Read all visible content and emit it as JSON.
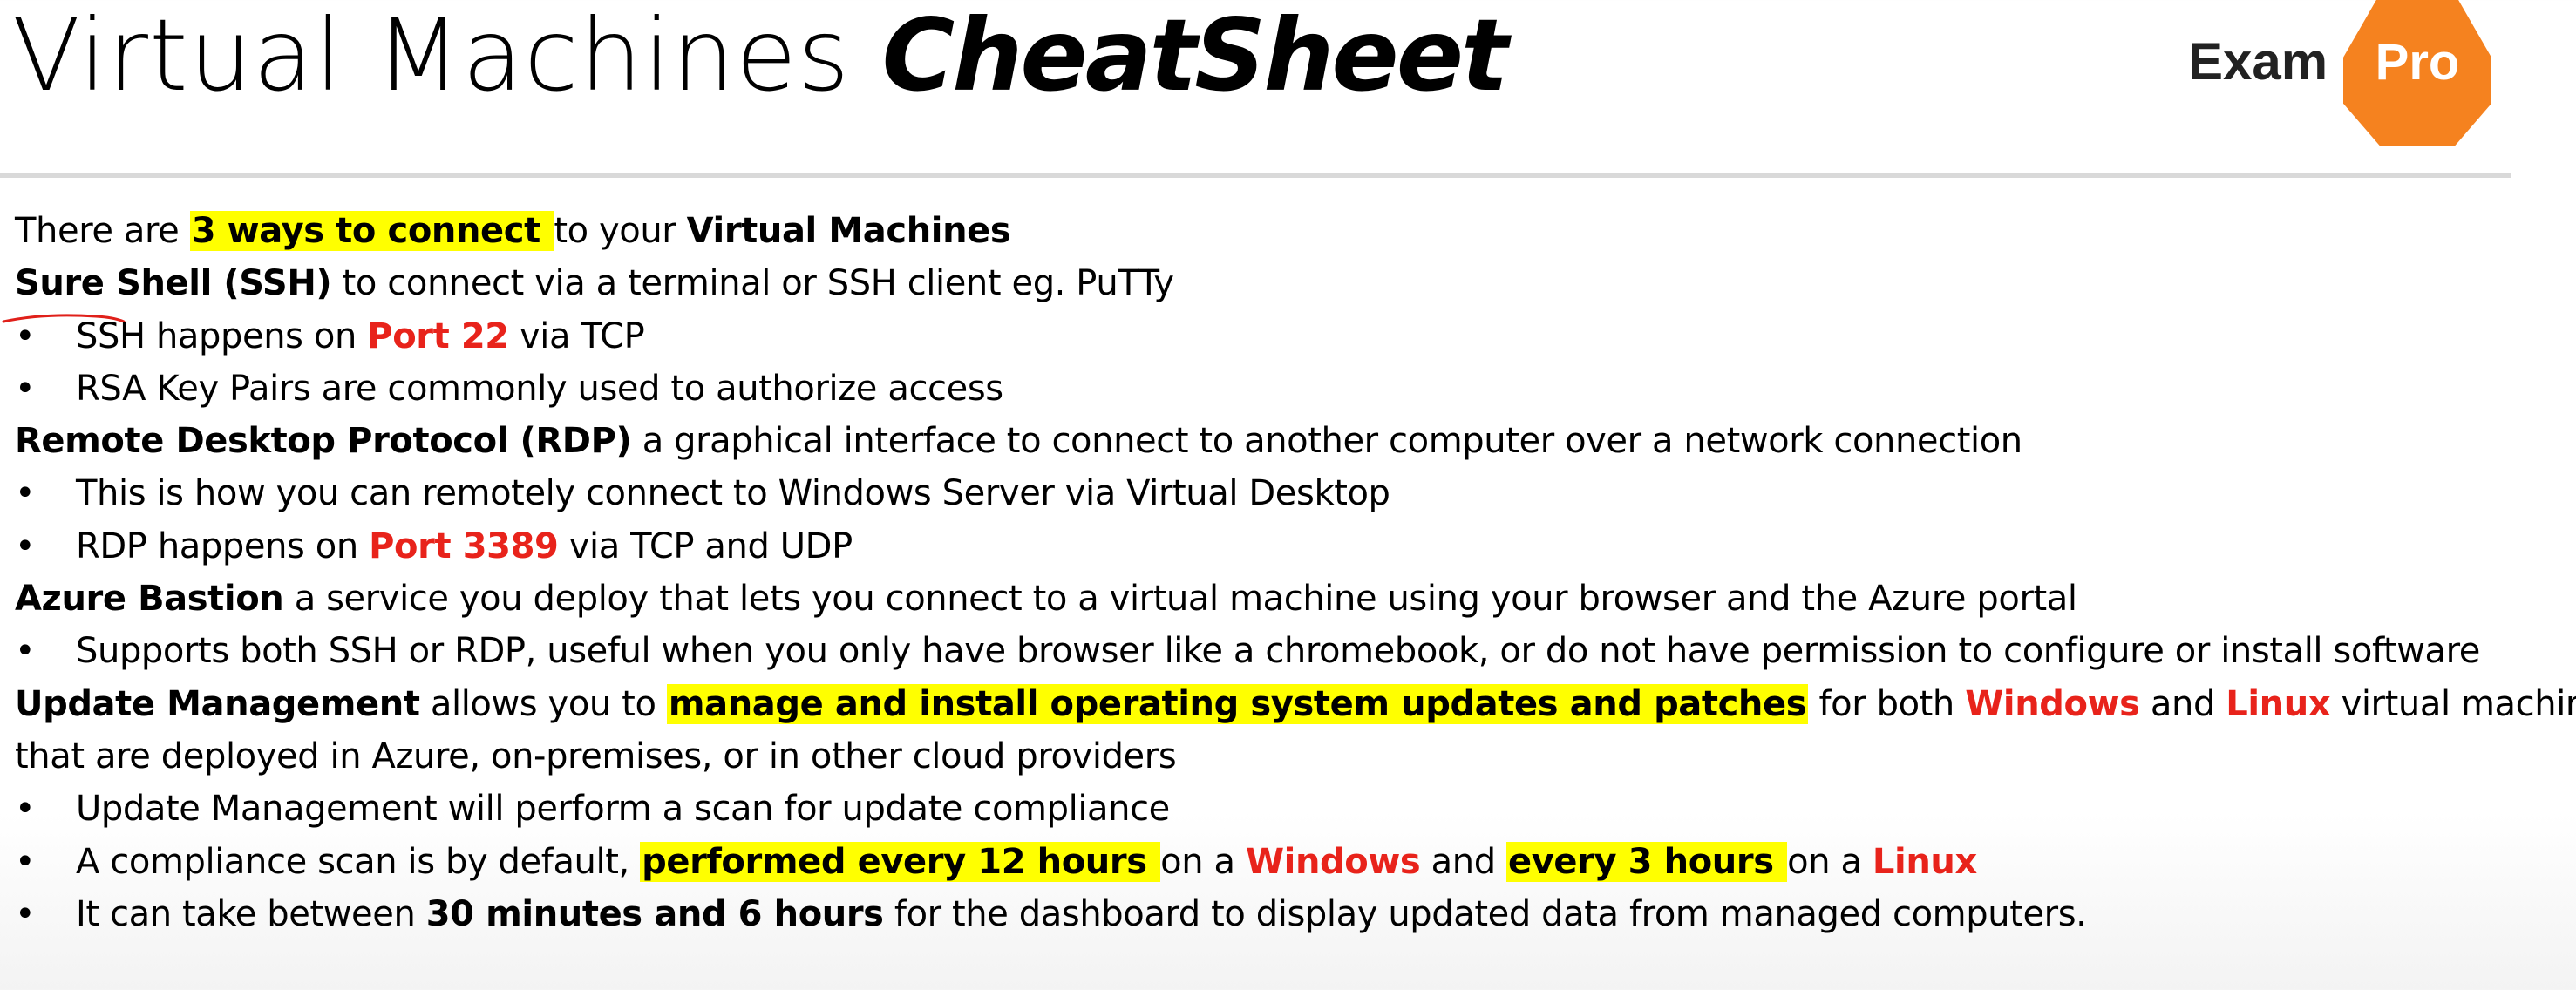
{
  "header": {
    "title_light": "Virtual Machines",
    "title_bold": "CheatSheet",
    "logo_left": "Exam",
    "logo_right": "Pro",
    "brand_color": "#f5821f"
  },
  "lines": [
    {
      "bullet": false,
      "segments": [
        {
          "t": "There are ",
          "s": ""
        },
        {
          "t": "3 ways to connect ",
          "s": "b hl"
        },
        {
          "t": "to your ",
          "s": ""
        },
        {
          "t": "Virtual Machines",
          "s": "b"
        }
      ]
    },
    {
      "bullet": false,
      "segments": [
        {
          "t": "Sure Shell (SSH)",
          "s": "b"
        },
        {
          "t": " to connect via a terminal or SSH client eg. PuTTy",
          "s": ""
        }
      ]
    },
    {
      "bullet": true,
      "segments": [
        {
          "t": "SSH happens on ",
          "s": ""
        },
        {
          "t": "Port 22",
          "s": "red"
        },
        {
          "t": " via TCP",
          "s": ""
        }
      ]
    },
    {
      "bullet": true,
      "segments": [
        {
          "t": "RSA Key Pairs are commonly used to authorize access",
          "s": ""
        }
      ]
    },
    {
      "bullet": false,
      "segments": [
        {
          "t": "Remote Desktop Protocol (RDP)",
          "s": "b"
        },
        {
          "t": " a graphical interface to connect to another computer over a network connection",
          "s": ""
        }
      ]
    },
    {
      "bullet": true,
      "segments": [
        {
          "t": "This is how you can remotely connect to Windows Server via Virtual Desktop",
          "s": ""
        }
      ]
    },
    {
      "bullet": true,
      "segments": [
        {
          "t": "RDP happens on ",
          "s": ""
        },
        {
          "t": "Port 3389",
          "s": "red"
        },
        {
          "t": " via TCP and UDP",
          "s": ""
        }
      ]
    },
    {
      "bullet": false,
      "segments": [
        {
          "t": "Azure Bastion",
          "s": "b"
        },
        {
          "t": " a service you deploy that lets you connect to a virtual machine using your browser and the Azure portal",
          "s": ""
        }
      ]
    },
    {
      "bullet": true,
      "segments": [
        {
          "t": "Supports both SSH or RDP, useful when you only have browser like a chromebook, or do not have permission to configure or install software",
          "s": ""
        }
      ]
    },
    {
      "bullet": false,
      "segments": [
        {
          "t": "Update Management",
          "s": "b"
        },
        {
          "t": " allows you to ",
          "s": ""
        },
        {
          "t": "manage and install operating system updates and patches",
          "s": "b hl"
        },
        {
          "t": " for both ",
          "s": ""
        },
        {
          "t": "Windows",
          "s": "red"
        },
        {
          "t": " and ",
          "s": ""
        },
        {
          "t": "Linux",
          "s": "red"
        },
        {
          "t": " virtual machines",
          "s": ""
        }
      ]
    },
    {
      "bullet": false,
      "segments": [
        {
          "t": "that are deployed in Azure, on-premises, or in other cloud providers",
          "s": ""
        }
      ]
    },
    {
      "bullet": true,
      "segments": [
        {
          "t": "Update Management will perform a scan for update compliance",
          "s": ""
        }
      ]
    },
    {
      "bullet": true,
      "segments": [
        {
          "t": "A compliance scan is by default, ",
          "s": ""
        },
        {
          "t": "performed every 12 hours ",
          "s": "b hl"
        },
        {
          "t": "on a ",
          "s": ""
        },
        {
          "t": "Windows",
          "s": "red"
        },
        {
          "t": " and ",
          "s": ""
        },
        {
          "t": "every 3 hours ",
          "s": "b hl"
        },
        {
          "t": "on a ",
          "s": ""
        },
        {
          "t": "Linux",
          "s": "red"
        }
      ]
    },
    {
      "bullet": true,
      "segments": [
        {
          "t": "It can take between ",
          "s": ""
        },
        {
          "t": "30 minutes and 6 hours",
          "s": "b"
        },
        {
          "t": " for the dashboard to display updated data from managed computers.",
          "s": ""
        }
      ]
    }
  ],
  "bullet_char": "•",
  "colors": {
    "highlight": "#ffff00",
    "emphasis_red": "#e8231b",
    "pen_annotation": "#e0201a"
  }
}
